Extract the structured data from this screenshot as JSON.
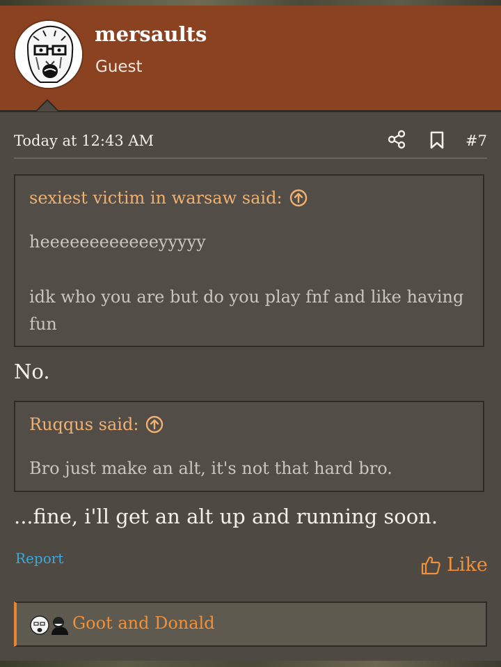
{
  "user": {
    "name": "mersaults",
    "title": "Guest",
    "avatar_icon": "wojak-avatar-icon"
  },
  "post": {
    "timestamp": "Today at 12:43 AM",
    "number": "#7"
  },
  "quotes": [
    {
      "attribution": "sexiest victim in warsaw said:",
      "lines": [
        "heeeeeeeeeeeeyyyyy",
        "idk who you are but do you play fnf and like having fun"
      ]
    },
    {
      "attribution": "Ruqqus said:",
      "lines": [
        "Bro just make an alt, it's not that hard bro."
      ]
    }
  ],
  "replies": [
    "No.",
    "...fine, i'll get an alt up and running soon."
  ],
  "actions": {
    "report": "Report",
    "like": "Like"
  },
  "reactions": {
    "text": "Goot and Donald"
  },
  "colors": {
    "header": "#8b4220",
    "background": "#4e4a43",
    "quote_attr": "#f0b072",
    "accent": "#f0903a",
    "link": "#3ea8d8"
  }
}
